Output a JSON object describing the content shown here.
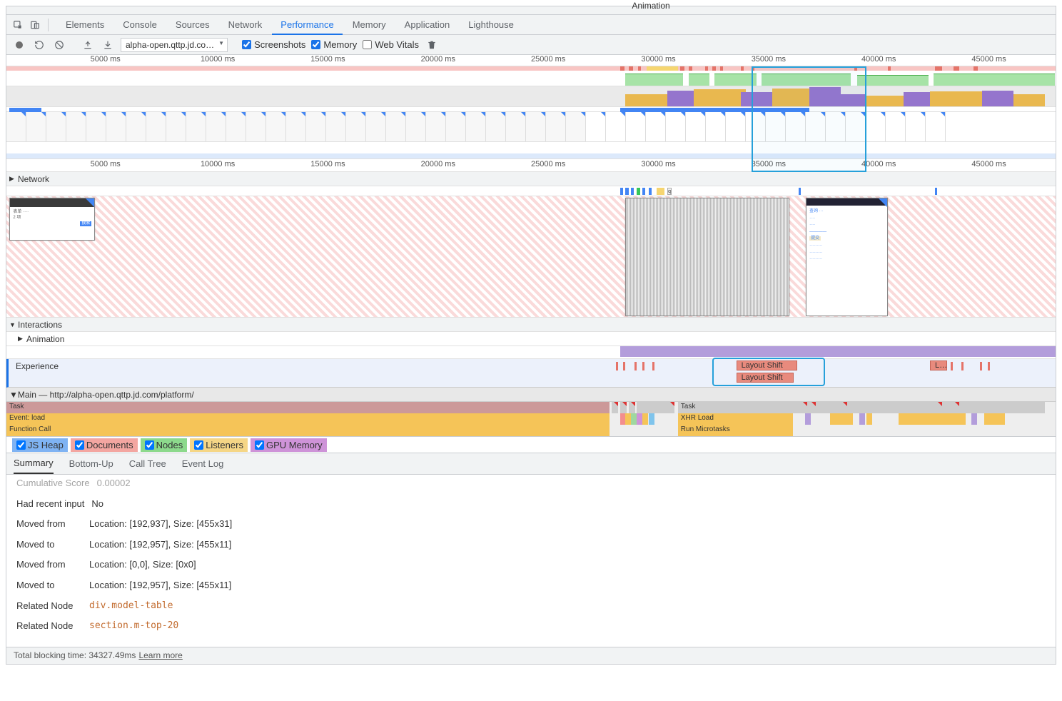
{
  "tabs": [
    "Elements",
    "Console",
    "Sources",
    "Network",
    "Performance",
    "Memory",
    "Application",
    "Lighthouse"
  ],
  "activeTab": "Performance",
  "toolbar": {
    "profileSelect": "alpha-open.qttp.jd.co…",
    "screenshots": "Screenshots",
    "memory": "Memory",
    "webVitals": "Web Vitals"
  },
  "ruler": {
    "ticks": [
      "5000 ms",
      "10000 ms",
      "15000 ms",
      "20000 ms",
      "25000 ms",
      "30000 ms",
      "35000 ms",
      "40000 ms",
      "45000 ms"
    ],
    "positions_pct": [
      8,
      18.5,
      29,
      39.5,
      50,
      60.5,
      71,
      81.5,
      92
    ]
  },
  "sections": {
    "network": "Network",
    "interactions": "Interactions",
    "animation": "Animation",
    "animationLabel": "Animation",
    "experience": "Experience",
    "layoutShift": "Layout Shift",
    "layoutShiftShort": "L…",
    "main": "Main — http://alpha-open.qttp.jd.com/platform/"
  },
  "flame": {
    "task": "Task",
    "eventLoad": "Event: load",
    "funcCall": "Function Call",
    "task2": "Task",
    "xhrLoad": "XHR Load",
    "runMicro": "Run Microtasks"
  },
  "memChecks": {
    "jsHeap": "JS Heap",
    "documents": "Documents",
    "nodes": "Nodes",
    "listeners": "Listeners",
    "gpu": "GPU Memory"
  },
  "subTabs": [
    "Summary",
    "Bottom-Up",
    "Call Tree",
    "Event Log"
  ],
  "summary": {
    "cumLabel": "Cumulative Score",
    "cumVal": "0.00002",
    "recentLabel": "Had recent input",
    "recentVal": "No",
    "mf1Label": "Moved from",
    "mf1Val": "Location: [192,937], Size: [455x31]",
    "mt1Label": "Moved to",
    "mt1Val": "Location: [192,957], Size: [455x11]",
    "mf2Label": "Moved from",
    "mf2Val": "Location: [0,0], Size: [0x0]",
    "mt2Label": "Moved to",
    "mt2Val": "Location: [192,957], Size: [455x11]",
    "rn1Label": "Related Node",
    "rn1Val": "div.model-table",
    "rn2Label": "Related Node",
    "rn2Val": "section.m-top-20"
  },
  "footer": {
    "text": "Total blocking time: 34327.49ms",
    "link": "Learn more"
  }
}
